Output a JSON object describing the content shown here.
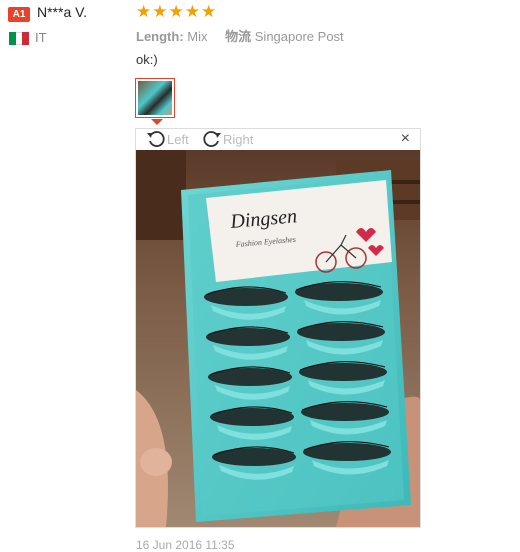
{
  "review": {
    "badge": "A1",
    "username": "N***a V.",
    "country": "IT",
    "flag_colors": [
      "#009246",
      "#ffffff",
      "#ce2b37"
    ],
    "rating": 5,
    "stars": [
      "★",
      "★",
      "★",
      "★",
      "★"
    ],
    "length_label": "Length:",
    "length_value": "Mix",
    "shipping_label": "物流",
    "shipping_value": "Singapore Post",
    "comment": "ok:)",
    "date": "16 Jun 2016 11:35"
  },
  "viewer": {
    "rotate_left_label": "Left",
    "rotate_right_label": "Right",
    "close_label": "×",
    "photo": {
      "brand": "Dingsen",
      "tagline": "Fashion Eyelashes"
    }
  },
  "colors": {
    "accent": "#e8432a",
    "star": "#f2a100",
    "tray": "#4ec8c8"
  }
}
